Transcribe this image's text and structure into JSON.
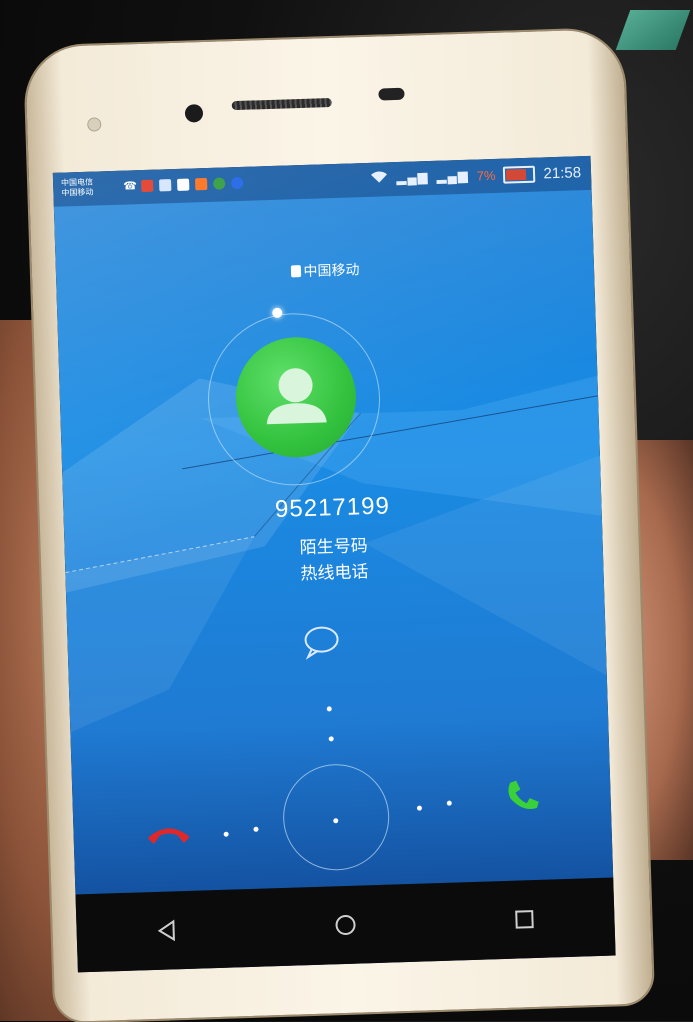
{
  "status_bar": {
    "carrier_line_1": "中国电信",
    "carrier_line_2": "中国移动",
    "time": "21:58",
    "battery_percent": "7%",
    "battery_level": 0.7,
    "icons_left": [
      "phone-icon",
      "app-icon",
      "mail-icon",
      "calendar-icon",
      "app-icon",
      "chrome-icon",
      "app-icon"
    ],
    "icons_right": [
      "wifi-icon",
      "signal-icon",
      "signal-icon",
      "battery-icon"
    ]
  },
  "call": {
    "carrier": "中国移动",
    "number": "95217199",
    "label_1": "陌生号码",
    "label_2": "热线电话"
  },
  "colors": {
    "avatar_green": "#33c23e",
    "decline_red": "#e0282a",
    "accept_green": "#3ad03a",
    "screen_blue": "#1a8ce4"
  },
  "nav": {
    "back_icon": "back-triangle-icon",
    "home_icon": "home-circle-icon",
    "recents_icon": "recents-square-icon"
  }
}
